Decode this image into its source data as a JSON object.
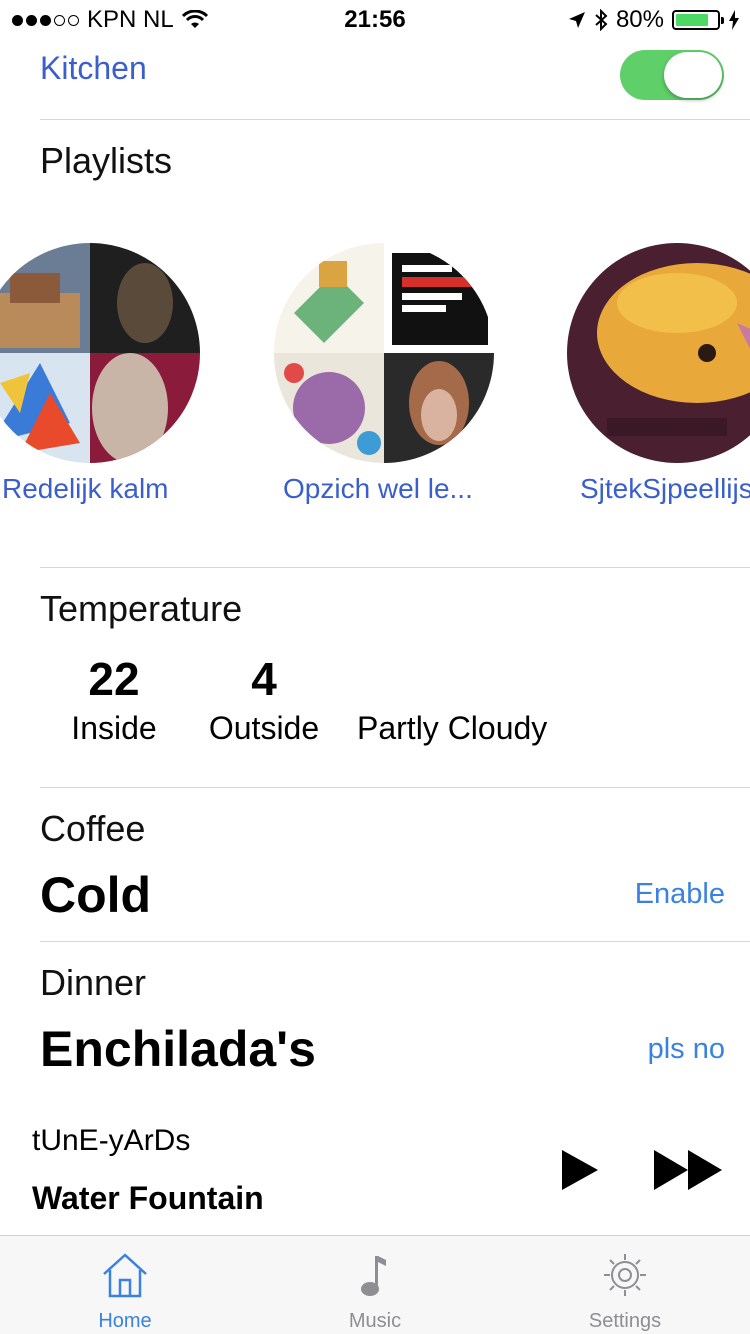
{
  "status_bar": {
    "signal_bars_filled": 3,
    "carrier": "KPN NL",
    "time": "21:56",
    "battery_percent": "80%",
    "battery_level": 0.8
  },
  "kitchen": {
    "label": "Kitchen",
    "toggle_on": true
  },
  "playlists": {
    "title": "Playlists",
    "items": [
      {
        "name": "Redelijk kalm"
      },
      {
        "name": "Opzich wel le..."
      },
      {
        "name": "SjtekSjpeellijs"
      }
    ]
  },
  "temperature": {
    "title": "Temperature",
    "inside_value": "22",
    "inside_label": "Inside",
    "outside_value": "4",
    "outside_label": "Outside",
    "condition": "Partly Cloudy"
  },
  "coffee": {
    "title": "Coffee",
    "status": "Cold",
    "action": "Enable"
  },
  "dinner": {
    "title": "Dinner",
    "value": "Enchilada's",
    "action": "pls no"
  },
  "now_playing": {
    "artist": "tUnE-yArDs",
    "track": "Water Fountain"
  },
  "tabs": [
    {
      "label": "Home",
      "icon": "house-icon",
      "active": true
    },
    {
      "label": "Music",
      "icon": "music-note-icon",
      "active": false
    },
    {
      "label": "Settings",
      "icon": "gear-icon",
      "active": false
    }
  ],
  "colors": {
    "accent": "#3b82e0",
    "title_blue": "#3a5fcd",
    "toggle_green": "#5fcf6a",
    "battery_green": "#4cd964"
  }
}
